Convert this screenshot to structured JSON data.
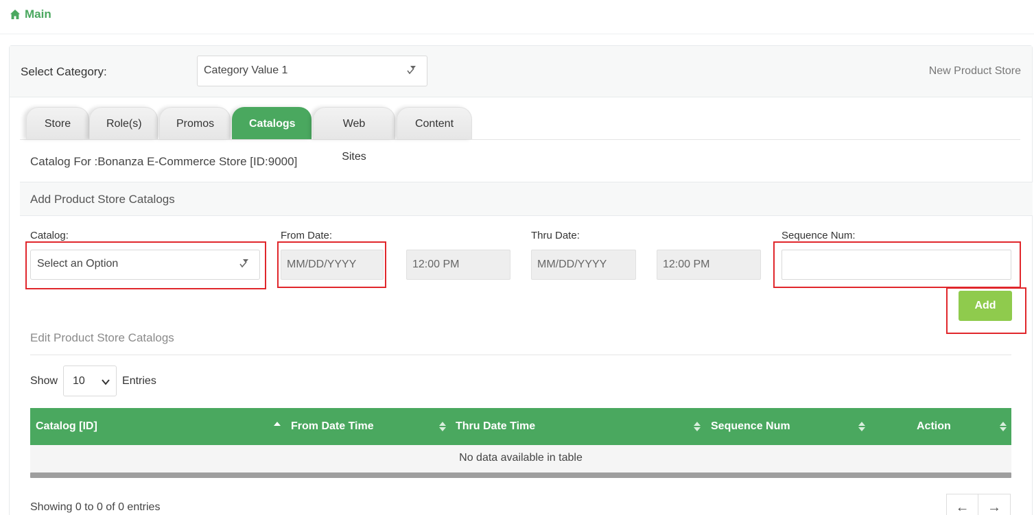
{
  "nav": {
    "main_label": "Main"
  },
  "header": {
    "select_category_label": "Select Category:",
    "category_value": "Category Value 1",
    "new_store_link": "New Product Store"
  },
  "tabs": [
    {
      "label": "Store",
      "active": false
    },
    {
      "label": "Role(s)",
      "active": false
    },
    {
      "label": "Promos",
      "active": false
    },
    {
      "label": "Catalogs",
      "active": true
    },
    {
      "label": "Web Sites",
      "active": false
    },
    {
      "label": "Content",
      "active": false
    }
  ],
  "catalog_for": "Catalog For :Bonanza E-Commerce Store [ID:9000]",
  "add_section": {
    "title": "Add Product Store Catalogs",
    "catalog_label": "Catalog:",
    "catalog_placeholder": "Select an Option",
    "from_date_label": "From Date:",
    "from_date_placeholder": "MM/DD/YYYY",
    "from_time_placeholder": "12:00 PM",
    "thru_date_label": "Thru Date:",
    "thru_date_placeholder": "MM/DD/YYYY",
    "thru_time_placeholder": "12:00 PM",
    "sequence_label": "Sequence Num:",
    "sequence_value": "",
    "add_button": "Add"
  },
  "edit_section": {
    "title": "Edit Product Store Catalogs",
    "show_label": "Show",
    "page_length": "10",
    "entries_label": "Entries",
    "columns": [
      "Catalog [ID]",
      "From Date Time",
      "Thru Date Time",
      "Sequence Num",
      "Action"
    ],
    "empty_message": "No data available in table",
    "showing_text": "Showing 0 to 0 of 0 entries",
    "prev_label": "←",
    "next_label": "→"
  },
  "colors": {
    "accent_green": "#4aa85f",
    "add_button_green": "#8fcb4d",
    "highlight_red": "#e0262b"
  }
}
